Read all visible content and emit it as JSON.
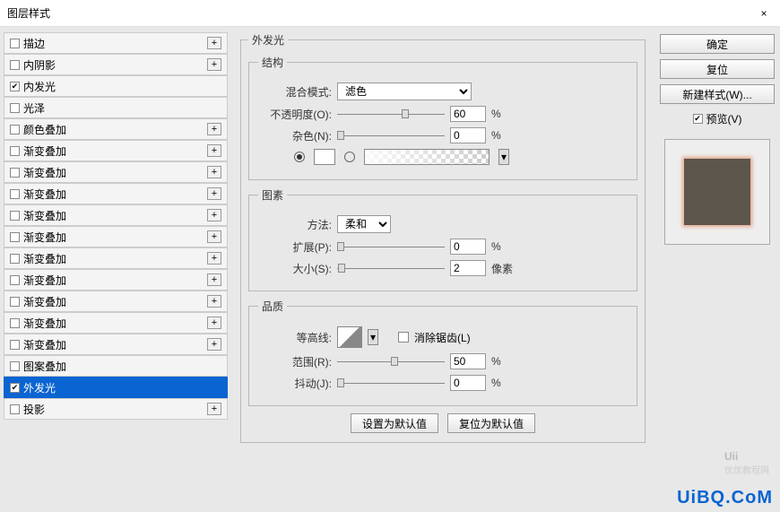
{
  "window": {
    "title": "图层样式",
    "close": "×"
  },
  "sidebar": {
    "items": [
      {
        "label": "描边",
        "checked": false,
        "plus": true
      },
      {
        "label": "内阴影",
        "checked": false,
        "plus": true
      },
      {
        "label": "内发光",
        "checked": true,
        "plus": false
      },
      {
        "label": "光泽",
        "checked": false,
        "plus": false
      },
      {
        "label": "颜色叠加",
        "checked": false,
        "plus": true
      },
      {
        "label": "渐变叠加",
        "checked": false,
        "plus": true
      },
      {
        "label": "渐变叠加",
        "checked": false,
        "plus": true
      },
      {
        "label": "渐变叠加",
        "checked": false,
        "plus": true
      },
      {
        "label": "渐变叠加",
        "checked": false,
        "plus": true
      },
      {
        "label": "渐变叠加",
        "checked": false,
        "plus": true
      },
      {
        "label": "渐变叠加",
        "checked": false,
        "plus": true
      },
      {
        "label": "渐变叠加",
        "checked": false,
        "plus": true
      },
      {
        "label": "渐变叠加",
        "checked": false,
        "plus": true
      },
      {
        "label": "渐变叠加",
        "checked": false,
        "plus": true
      },
      {
        "label": "渐变叠加",
        "checked": false,
        "plus": true
      },
      {
        "label": "图案叠加",
        "checked": false,
        "plus": false
      },
      {
        "label": "外发光",
        "checked": true,
        "plus": false,
        "selected": true
      },
      {
        "label": "投影",
        "checked": false,
        "plus": true
      }
    ]
  },
  "panel": {
    "title": "外发光",
    "structure": {
      "legend": "结构",
      "blend_label": "混合模式:",
      "blend_value": "滤色",
      "opacity_label": "不透明度(O):",
      "opacity_value": "60",
      "opacity_unit": "%",
      "noise_label": "杂色(N):",
      "noise_value": "0",
      "noise_unit": "%"
    },
    "elements": {
      "legend": "图素",
      "method_label": "方法:",
      "method_value": "柔和",
      "spread_label": "扩展(P):",
      "spread_value": "0",
      "spread_unit": "%",
      "size_label": "大小(S):",
      "size_value": "2",
      "size_unit": "像素"
    },
    "quality": {
      "legend": "品质",
      "contour_label": "等高线:",
      "antialias_label": "消除锯齿(L)",
      "range_label": "范围(R):",
      "range_value": "50",
      "range_unit": "%",
      "jitter_label": "抖动(J):",
      "jitter_value": "0",
      "jitter_unit": "%"
    },
    "defaults": {
      "set_default": "设置为默认值",
      "reset_default": "复位为默认值"
    }
  },
  "buttons": {
    "ok": "确定",
    "reset": "复位",
    "new_style": "新建样式(W)...",
    "preview": "预览(V)"
  },
  "watermark": {
    "main": "UiBQ.CoM",
    "logo": "Uii",
    "sub": "优优教程网"
  }
}
